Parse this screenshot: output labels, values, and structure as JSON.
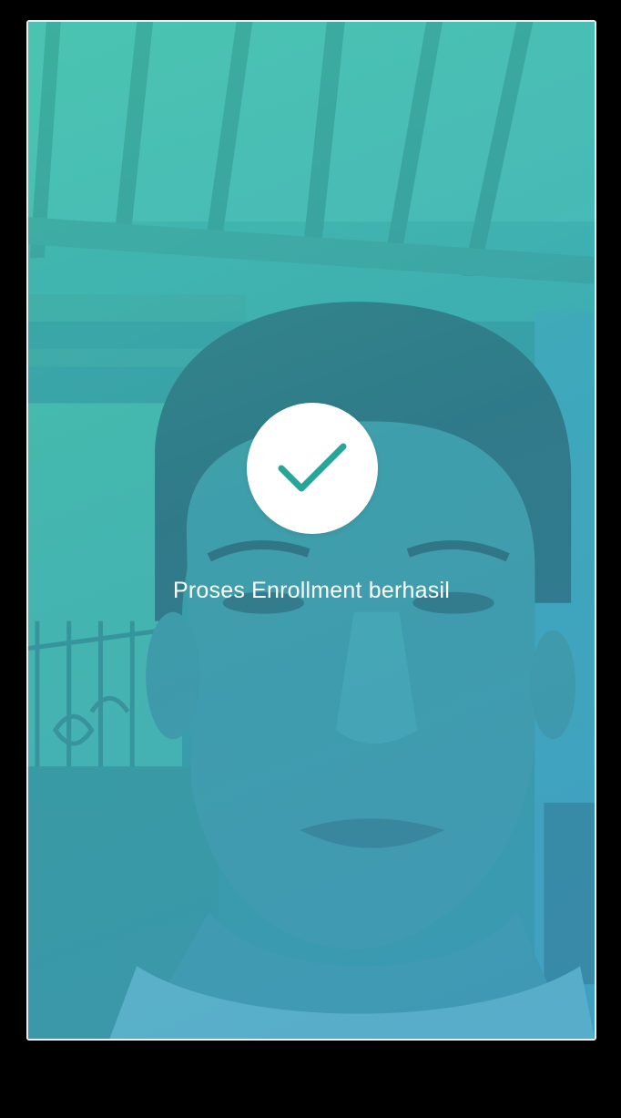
{
  "status_bar": {
    "left": "",
    "right": ""
  },
  "enrollment": {
    "success_message": "Proses Enrollment berhasil",
    "icon": "checkmark-icon"
  },
  "colors": {
    "accent": "#26a69a",
    "overlay_top": "#48ceb2",
    "overlay_bottom": "#45a0cd",
    "frame_border": "#e9eef0",
    "background": "#000000"
  }
}
